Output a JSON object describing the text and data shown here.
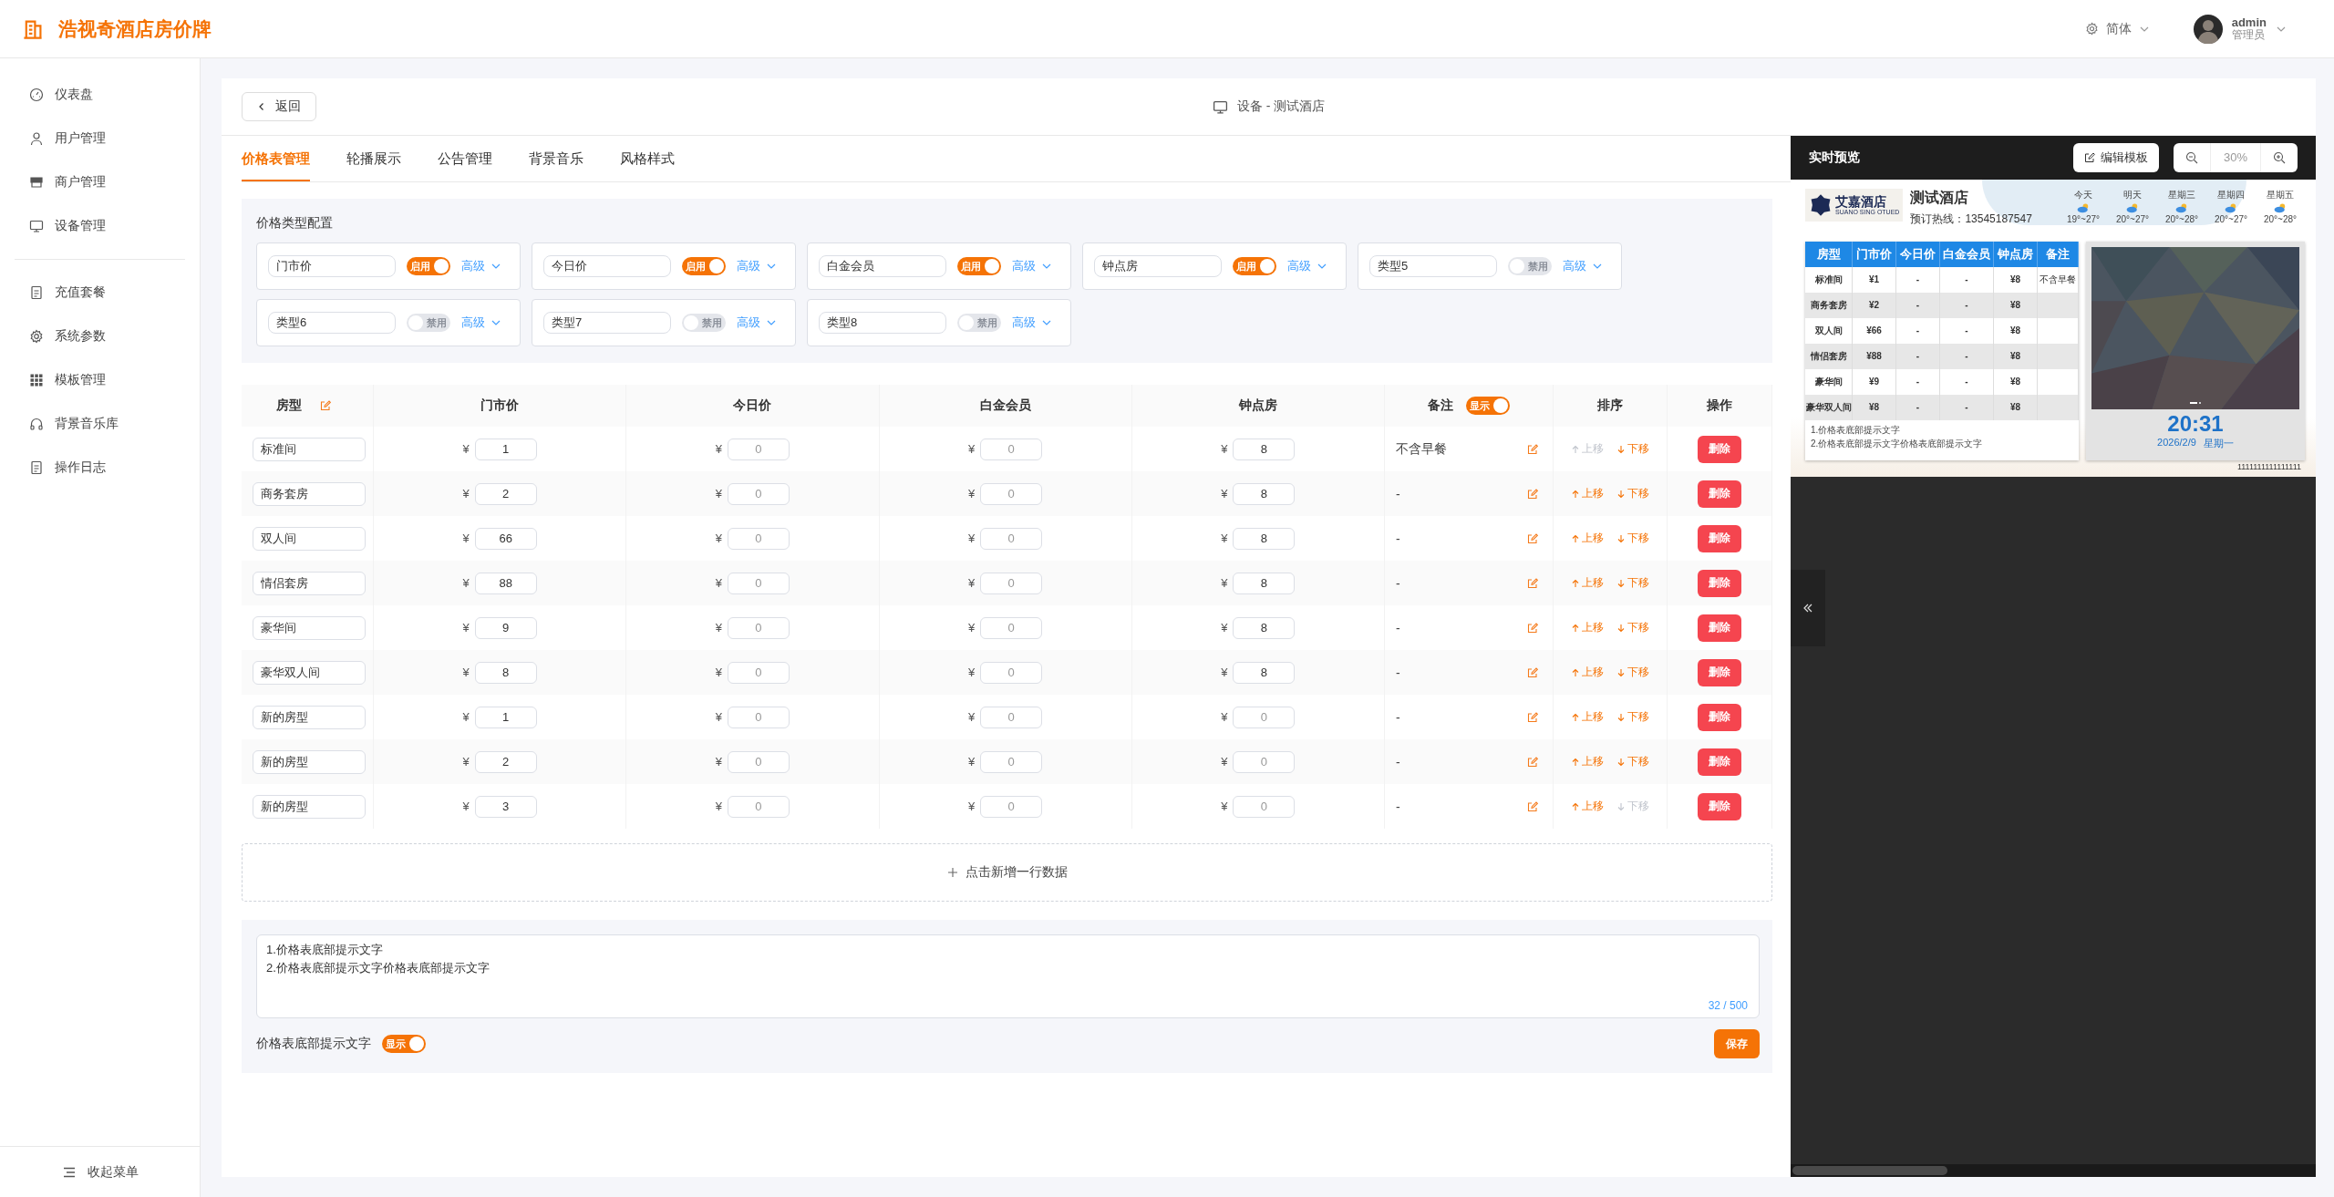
{
  "app": {
    "title": "浩视奇酒店房价牌"
  },
  "header": {
    "language": "简体",
    "user": {
      "name": "admin",
      "role": "管理员"
    }
  },
  "sidebar": {
    "groups": [
      [
        {
          "label": "仪表盘",
          "kind": "gauge"
        },
        {
          "label": "用户管理",
          "kind": "user"
        },
        {
          "label": "商户管理",
          "kind": "shop"
        },
        {
          "label": "设备管理",
          "kind": "monitor"
        }
      ],
      [
        {
          "label": "充值套餐",
          "kind": "doc"
        },
        {
          "label": "系统参数",
          "kind": "gear"
        },
        {
          "label": "模板管理",
          "kind": "grid"
        },
        {
          "label": "背景音乐库",
          "kind": "headphones"
        },
        {
          "label": "操作日志",
          "kind": "doc"
        }
      ]
    ],
    "collapse": "收起菜单"
  },
  "page": {
    "back": "返回",
    "title": "设备 - 测试酒店"
  },
  "tabs": [
    {
      "label": "价格表管理",
      "selected": true
    },
    {
      "label": "轮播展示",
      "selected": false
    },
    {
      "label": "公告管理",
      "selected": false
    },
    {
      "label": "背景音乐",
      "selected": false
    },
    {
      "label": "风格样式",
      "selected": false
    }
  ],
  "price_types": {
    "title": "价格类型配置",
    "items": [
      {
        "name": "门市价",
        "enabled": true,
        "switch_text": "启用",
        "advanced": "高级"
      },
      {
        "name": "今日价",
        "enabled": true,
        "switch_text": "启用",
        "advanced": "高级"
      },
      {
        "name": "白金会员",
        "enabled": true,
        "switch_text": "启用",
        "advanced": "高级"
      },
      {
        "name": "钟点房",
        "enabled": true,
        "switch_text": "启用",
        "advanced": "高级"
      },
      {
        "name": "类型5",
        "enabled": false,
        "switch_text": "禁用",
        "advanced": "高级"
      },
      {
        "name": "类型6",
        "enabled": false,
        "switch_text": "禁用",
        "advanced": "高级"
      },
      {
        "name": "类型7",
        "enabled": false,
        "switch_text": "禁用",
        "advanced": "高级"
      },
      {
        "name": "类型8",
        "enabled": false,
        "switch_text": "禁用",
        "advanced": "高级"
      }
    ]
  },
  "table": {
    "columns": [
      "房型",
      "门市价",
      "今日价",
      "白金会员",
      "钟点房",
      "备注",
      "排序",
      "操作"
    ],
    "remark_switch": {
      "on": true,
      "text": "显示"
    },
    "rows": [
      {
        "name": "标准间",
        "prices": [
          {
            "currency": "¥",
            "value": "1"
          },
          {
            "currency": "¥",
            "placeholder": "0"
          },
          {
            "currency": "¥",
            "placeholder": "0"
          },
          {
            "currency": "¥",
            "value": "8"
          }
        ],
        "remark": "不含早餐",
        "up": "上移",
        "down": "下移",
        "delete": "删除",
        "up_disabled": true,
        "down_disabled": false
      },
      {
        "name": "商务套房",
        "prices": [
          {
            "currency": "¥",
            "value": "2"
          },
          {
            "currency": "¥",
            "placeholder": "0"
          },
          {
            "currency": "¥",
            "placeholder": "0"
          },
          {
            "currency": "¥",
            "value": "8"
          }
        ],
        "remark": "-",
        "up": "上移",
        "down": "下移",
        "delete": "删除",
        "up_disabled": false,
        "down_disabled": false
      },
      {
        "name": "双人间",
        "prices": [
          {
            "currency": "¥",
            "value": "66"
          },
          {
            "currency": "¥",
            "placeholder": "0"
          },
          {
            "currency": "¥",
            "placeholder": "0"
          },
          {
            "currency": "¥",
            "value": "8"
          }
        ],
        "remark": "-",
        "up": "上移",
        "down": "下移",
        "delete": "删除",
        "up_disabled": false,
        "down_disabled": false
      },
      {
        "name": "情侣套房",
        "prices": [
          {
            "currency": "¥",
            "value": "88"
          },
          {
            "currency": "¥",
            "placeholder": "0"
          },
          {
            "currency": "¥",
            "placeholder": "0"
          },
          {
            "currency": "¥",
            "value": "8"
          }
        ],
        "remark": "-",
        "up": "上移",
        "down": "下移",
        "delete": "删除",
        "up_disabled": false,
        "down_disabled": false
      },
      {
        "name": "豪华间",
        "prices": [
          {
            "currency": "¥",
            "value": "9"
          },
          {
            "currency": "¥",
            "placeholder": "0"
          },
          {
            "currency": "¥",
            "placeholder": "0"
          },
          {
            "currency": "¥",
            "value": "8"
          }
        ],
        "remark": "-",
        "up": "上移",
        "down": "下移",
        "delete": "删除",
        "up_disabled": false,
        "down_disabled": false
      },
      {
        "name": "豪华双人间",
        "prices": [
          {
            "currency": "¥",
            "value": "8"
          },
          {
            "currency": "¥",
            "placeholder": "0"
          },
          {
            "currency": "¥",
            "placeholder": "0"
          },
          {
            "currency": "¥",
            "value": "8"
          }
        ],
        "remark": "-",
        "up": "上移",
        "down": "下移",
        "delete": "删除",
        "up_disabled": false,
        "down_disabled": false
      },
      {
        "name": "新的房型",
        "prices": [
          {
            "currency": "¥",
            "value": "1"
          },
          {
            "currency": "¥",
            "placeholder": "0"
          },
          {
            "currency": "¥",
            "placeholder": "0"
          },
          {
            "currency": "¥",
            "placeholder": "0"
          }
        ],
        "remark": "-",
        "up": "上移",
        "down": "下移",
        "delete": "删除",
        "up_disabled": false,
        "down_disabled": false
      },
      {
        "name": "新的房型",
        "prices": [
          {
            "currency": "¥",
            "value": "2"
          },
          {
            "currency": "¥",
            "placeholder": "0"
          },
          {
            "currency": "¥",
            "placeholder": "0"
          },
          {
            "currency": "¥",
            "placeholder": "0"
          }
        ],
        "remark": "-",
        "up": "上移",
        "down": "下移",
        "delete": "删除",
        "up_disabled": false,
        "down_disabled": false
      },
      {
        "name": "新的房型",
        "prices": [
          {
            "currency": "¥",
            "value": "3"
          },
          {
            "currency": "¥",
            "placeholder": "0"
          },
          {
            "currency": "¥",
            "placeholder": "0"
          },
          {
            "currency": "¥",
            "placeholder": "0"
          }
        ],
        "remark": "-",
        "up": "上移",
        "down": "下移",
        "delete": "删除",
        "up_disabled": false,
        "down_disabled": true
      }
    ],
    "add_row": "点击新增一行数据"
  },
  "footer_note": {
    "lines": [
      "1.价格表底部提示文字",
      "2.价格表底部提示文字价格表底部提示文字"
    ],
    "counter": "32 / 500",
    "label": "价格表底部提示文字",
    "switch": {
      "on": true,
      "text": "显示"
    },
    "save": "保存"
  },
  "preview": {
    "title": "实时预览",
    "edit": "编辑模板",
    "zoom": "30%",
    "screen": {
      "logo": {
        "name": "艾嘉酒店",
        "subtitle": "SUANO SING OTUED"
      },
      "hotel": "测试酒店",
      "hotline": "预订热线：13545187547",
      "weather": [
        {
          "day": "今天",
          "temp": "19°~27°"
        },
        {
          "day": "明天",
          "temp": "20°~27°"
        },
        {
          "day": "星期三",
          "temp": "20°~28°"
        },
        {
          "day": "星期四",
          "temp": "20°~27°"
        },
        {
          "day": "星期五",
          "temp": "20°~28°"
        }
      ],
      "columns": [
        "房型",
        "门市价",
        "今日价",
        "白金会员",
        "钟点房",
        "备注"
      ],
      "rows": [
        {
          "cells": [
            "标准间",
            "¥1",
            "-",
            "-",
            "¥8"
          ],
          "remark": "不含早餐"
        },
        {
          "cells": [
            "商务套房",
            "¥2",
            "-",
            "-",
            "¥8"
          ]
        },
        {
          "cells": [
            "双人间",
            "¥66",
            "-",
            "-",
            "¥8"
          ]
        },
        {
          "cells": [
            "情侣套房",
            "¥88",
            "-",
            "-",
            "¥8"
          ]
        },
        {
          "cells": [
            "豪华间",
            "¥9",
            "-",
            "-",
            "¥8"
          ]
        },
        {
          "cells": [
            "豪华双人间",
            "¥8",
            "-",
            "-",
            "¥8"
          ]
        }
      ],
      "notes": [
        "1.价格表底部提示文字",
        "2.价格表底部提示文字价格表底部提示文字"
      ],
      "time": "20:31",
      "date": "2026/2/9",
      "weekday": "星期一",
      "marquee": "1111111111111111"
    }
  }
}
